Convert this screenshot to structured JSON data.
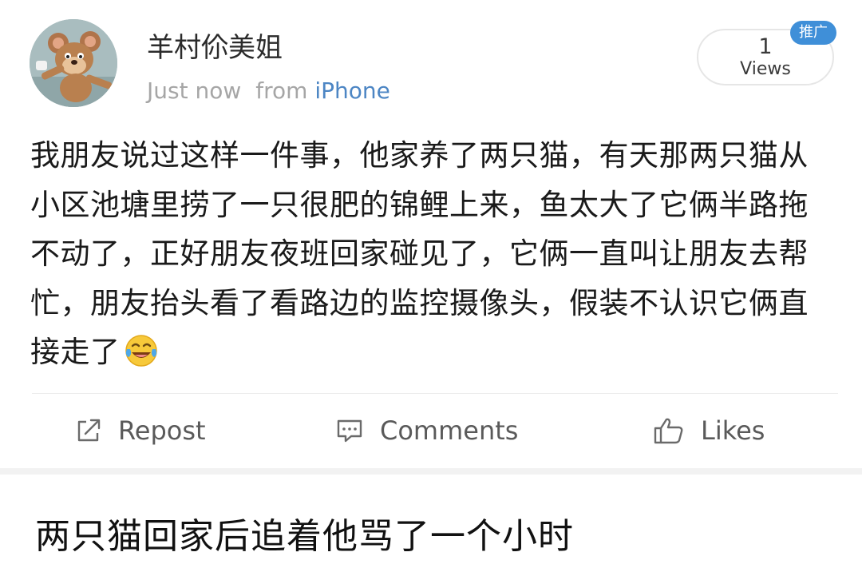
{
  "post": {
    "author": {
      "name": "羊村伱美姐",
      "avatar": "tom-and-jerry-cartoon-avatar"
    },
    "meta": {
      "time": "Just now",
      "from_prefix": "from",
      "source": "iPhone"
    },
    "views": {
      "count": "1",
      "label": "Views",
      "promo_badge": "推广"
    },
    "text": "我朋友说过这样一件事，他家养了两只猫，有天那两只猫从小区池塘里捞了一只很肥的锦鲤上来，鱼太大了它俩半路拖不动了，正好朋友夜班回家碰见了，它俩一直叫让朋友去帮忙，朋友抬头看了看路边的监控摄像头，假装不认识它俩直接走了",
    "emoji": "laughing-crying-emoji",
    "actions": {
      "repost": "Repost",
      "comments": "Comments",
      "likes": "Likes"
    }
  },
  "caption": "两只猫回家后追着他骂了一个小时",
  "colors": {
    "source_link": "#4d86c4",
    "badge": "#3f8fd8",
    "meta_gray": "#a6a6a6"
  }
}
